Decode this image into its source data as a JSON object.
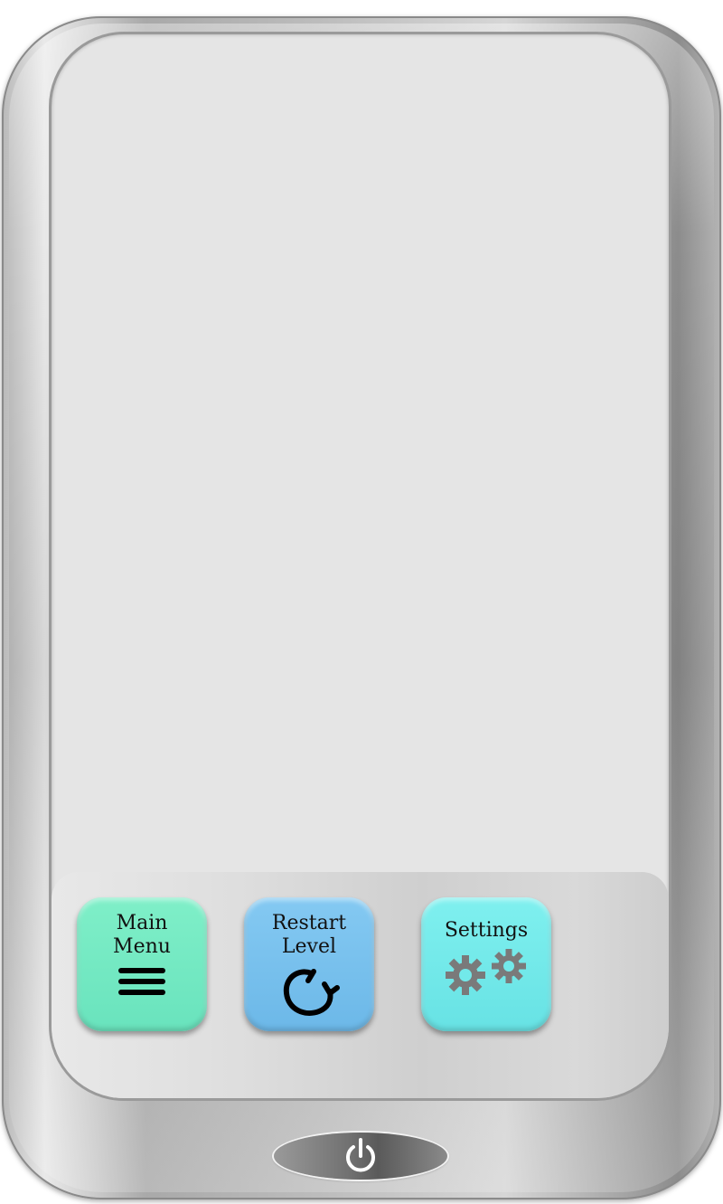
{
  "buttons": {
    "main_menu": {
      "label": "Main\nMenu",
      "icon": "hamburger-menu-icon",
      "color": "#72e8c3"
    },
    "restart_level": {
      "label": "Restart\nLevel",
      "icon": "restart-arrow-icon",
      "color": "#77c0ed"
    },
    "settings": {
      "label": "Settings",
      "icon": "gears-icon",
      "color": "#72e9ea"
    }
  },
  "power_button": {
    "icon": "power-icon"
  },
  "colors": {
    "screen": "#e5e5e5",
    "bezel": "#b0b0b0",
    "gear": "#7a7a7a"
  }
}
